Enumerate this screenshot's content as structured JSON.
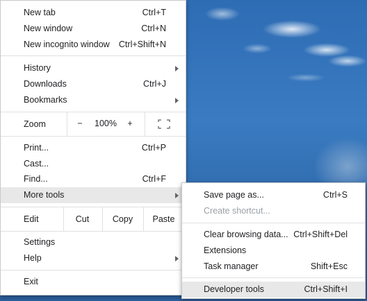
{
  "main_menu": {
    "new_tab": {
      "label": "New tab",
      "accel": "Ctrl+T"
    },
    "new_window": {
      "label": "New window",
      "accel": "Ctrl+N"
    },
    "new_incognito": {
      "label": "New incognito window",
      "accel": "Ctrl+Shift+N"
    },
    "history": {
      "label": "History"
    },
    "downloads": {
      "label": "Downloads",
      "accel": "Ctrl+J"
    },
    "bookmarks": {
      "label": "Bookmarks"
    },
    "zoom": {
      "label": "Zoom",
      "minus": "−",
      "value": "100%",
      "plus": "+"
    },
    "print": {
      "label": "Print...",
      "accel": "Ctrl+P"
    },
    "cast": {
      "label": "Cast..."
    },
    "find": {
      "label": "Find...",
      "accel": "Ctrl+F"
    },
    "more_tools": {
      "label": "More tools"
    },
    "edit": {
      "label": "Edit",
      "cut": "Cut",
      "copy": "Copy",
      "paste": "Paste"
    },
    "settings": {
      "label": "Settings"
    },
    "help": {
      "label": "Help"
    },
    "exit": {
      "label": "Exit"
    }
  },
  "more_tools_menu": {
    "save_page": {
      "label": "Save page as...",
      "accel": "Ctrl+S"
    },
    "create_shortcut": {
      "label": "Create shortcut..."
    },
    "clear_browsing": {
      "label": "Clear browsing data...",
      "accel": "Ctrl+Shift+Del"
    },
    "extensions": {
      "label": "Extensions"
    },
    "task_manager": {
      "label": "Task manager",
      "accel": "Shift+Esc"
    },
    "developer_tools": {
      "label": "Developer tools",
      "accel": "Ctrl+Shift+I"
    }
  },
  "icons": {
    "submenu_arrow": "chevron-right-icon",
    "fullscreen": "fullscreen-icon"
  },
  "colors": {
    "menu_bg": "#ffffff",
    "highlight": "#e8e8e8",
    "separator": "#e0e0e0",
    "disabled_text": "#9aa0a6"
  }
}
